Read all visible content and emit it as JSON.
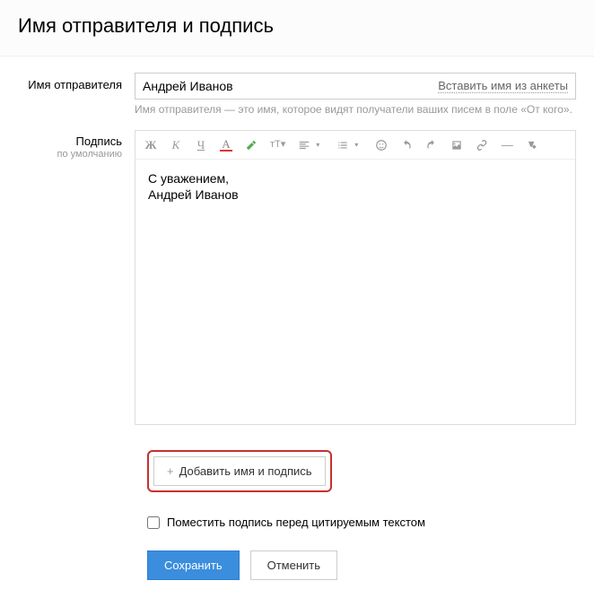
{
  "header": {
    "title": "Имя отправителя и подпись"
  },
  "sender": {
    "label": "Имя отправителя",
    "value": "Андрей Иванов",
    "insert_link": "Вставить имя из анкеты",
    "hint": "Имя отправителя — это имя, которое видят получатели ваших писем в поле «От кого»."
  },
  "signature": {
    "label_line1": "Подпись",
    "label_line2": "по умолчанию",
    "body": "С уважением,\nАндрей Иванов"
  },
  "toolbar": {
    "bold": "Ж",
    "italic": "К",
    "underline": "Ч",
    "colorA": "А"
  },
  "add_button": {
    "plus": "+",
    "label": "Добавить имя и подпись"
  },
  "checkbox": {
    "label": "Поместить подпись перед цитируемым текстом",
    "checked": false
  },
  "buttons": {
    "save": "Сохранить",
    "cancel": "Отменить"
  }
}
